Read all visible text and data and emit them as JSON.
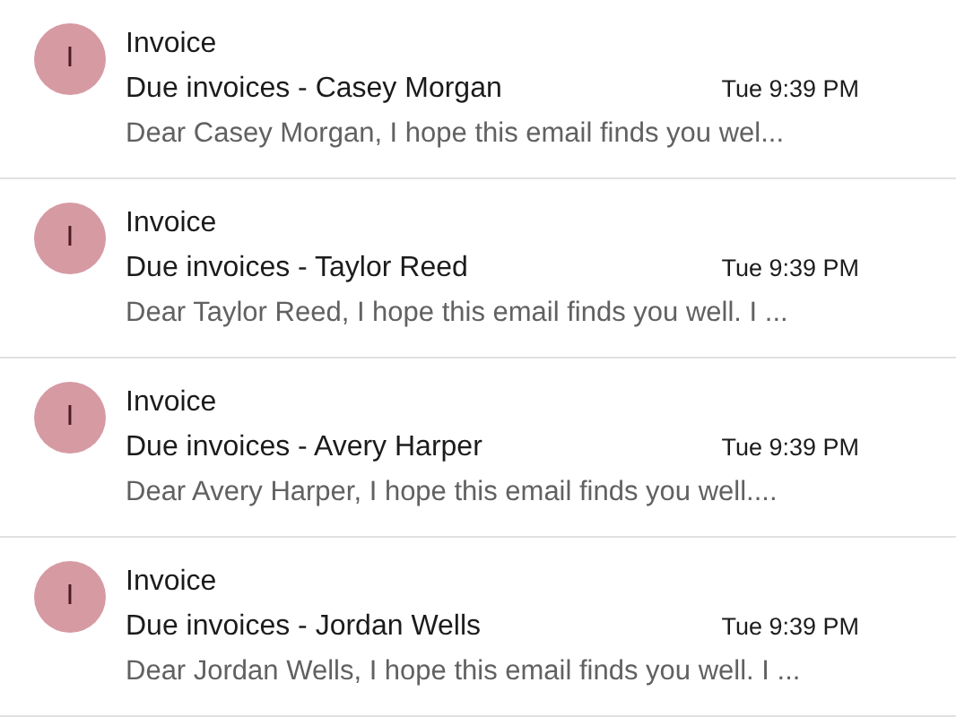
{
  "emails": [
    {
      "avatar": "I",
      "sender": "Invoice",
      "subject": "Due invoices - Casey Morgan",
      "time": "Tue 9:39 PM",
      "preview": "Dear Casey Morgan, I hope this email finds you wel..."
    },
    {
      "avatar": "I",
      "sender": "Invoice",
      "subject": "Due invoices - Taylor Reed",
      "time": "Tue 9:39 PM",
      "preview": "Dear Taylor Reed, I hope this email finds you well. I ..."
    },
    {
      "avatar": "I",
      "sender": "Invoice",
      "subject": "Due invoices - Avery Harper",
      "time": "Tue 9:39 PM",
      "preview": "Dear Avery Harper, I hope this email finds you well...."
    },
    {
      "avatar": "I",
      "sender": "Invoice",
      "subject": "Due invoices - Jordan Wells",
      "time": "Tue 9:39 PM",
      "preview": "Dear Jordan Wells, I hope this email finds you well. I ..."
    }
  ]
}
